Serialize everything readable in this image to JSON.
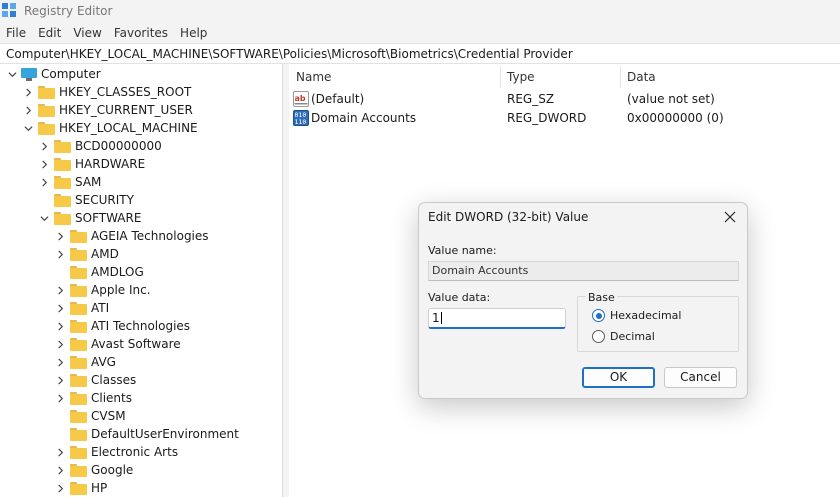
{
  "window": {
    "title": "Registry Editor",
    "icon": "registry-editor-icon"
  },
  "menu": [
    "File",
    "Edit",
    "View",
    "Favorites",
    "Help"
  ],
  "address": "Computer\\HKEY_LOCAL_MACHINE\\SOFTWARE\\Policies\\Microsoft\\Biometrics\\Credential Provider",
  "tree": {
    "root": "Computer",
    "items": [
      {
        "label": "HKEY_CLASSES_ROOT",
        "level": 1,
        "state": "collapsed"
      },
      {
        "label": "HKEY_CURRENT_USER",
        "level": 1,
        "state": "collapsed"
      },
      {
        "label": "HKEY_LOCAL_MACHINE",
        "level": 1,
        "state": "expanded"
      },
      {
        "label": "BCD00000000",
        "level": 2,
        "state": "collapsed"
      },
      {
        "label": "HARDWARE",
        "level": 2,
        "state": "collapsed"
      },
      {
        "label": "SAM",
        "level": 2,
        "state": "collapsed"
      },
      {
        "label": "SECURITY",
        "level": 2,
        "state": "leaf"
      },
      {
        "label": "SOFTWARE",
        "level": 2,
        "state": "expanded"
      },
      {
        "label": "AGEIA Technologies",
        "level": 3,
        "state": "collapsed"
      },
      {
        "label": "AMD",
        "level": 3,
        "state": "collapsed"
      },
      {
        "label": "AMDLOG",
        "level": 3,
        "state": "leaf"
      },
      {
        "label": "Apple Inc.",
        "level": 3,
        "state": "collapsed"
      },
      {
        "label": "ATI",
        "level": 3,
        "state": "collapsed"
      },
      {
        "label": "ATI Technologies",
        "level": 3,
        "state": "collapsed"
      },
      {
        "label": "Avast Software",
        "level": 3,
        "state": "collapsed"
      },
      {
        "label": "AVG",
        "level": 3,
        "state": "collapsed"
      },
      {
        "label": "Classes",
        "level": 3,
        "state": "collapsed"
      },
      {
        "label": "Clients",
        "level": 3,
        "state": "collapsed"
      },
      {
        "label": "CVSM",
        "level": 3,
        "state": "leaf"
      },
      {
        "label": "DefaultUserEnvironment",
        "level": 3,
        "state": "leaf"
      },
      {
        "label": "Electronic Arts",
        "level": 3,
        "state": "collapsed"
      },
      {
        "label": "Google",
        "level": 3,
        "state": "collapsed"
      },
      {
        "label": "HP",
        "level": 3,
        "state": "collapsed"
      }
    ]
  },
  "list": {
    "columns": [
      "Name",
      "Type",
      "Data"
    ],
    "rows": [
      {
        "name": "(Default)",
        "type": "REG_SZ",
        "data": "(value not set)",
        "icon": "string-value-icon"
      },
      {
        "name": "Domain Accounts",
        "type": "REG_DWORD",
        "data": "0x00000000 (0)",
        "icon": "binary-value-icon"
      }
    ]
  },
  "dialog": {
    "title": "Edit DWORD (32-bit) Value",
    "value_name_label": "Value name:",
    "value_name": "Domain Accounts",
    "value_data_label": "Value data:",
    "value_data": "1",
    "base_label": "Base",
    "hex_label": "Hexadecimal",
    "dec_label": "Decimal",
    "selected_base": "Hexadecimal",
    "ok_label": "OK",
    "cancel_label": "Cancel"
  },
  "colors": {
    "accent": "#1f6ec7",
    "folder": "#f7c948"
  }
}
